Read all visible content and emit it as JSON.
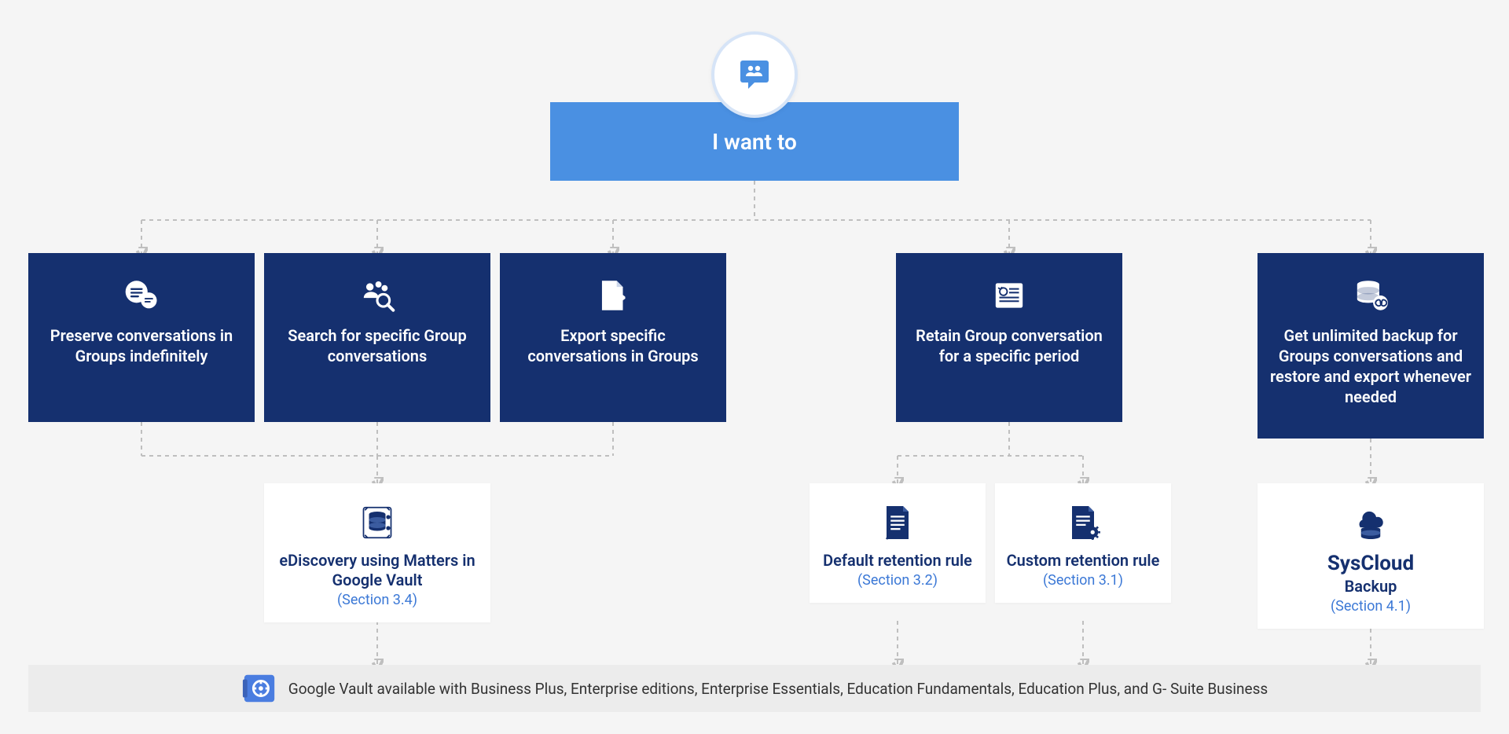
{
  "root": {
    "title": "I want to",
    "icon": "groups-chat-icon"
  },
  "options": [
    {
      "icon": "chat-bubbles-icon",
      "label": "Preserve conversations in Groups indefinitely"
    },
    {
      "icon": "people-search-icon",
      "label": "Search for specific Group conversations"
    },
    {
      "icon": "file-export-icon",
      "label": "Export specific conversations in Groups"
    },
    {
      "icon": "retention-window-icon",
      "label": "Retain Group conversation for a specific period"
    },
    {
      "icon": "database-infinity-icon",
      "label": "Get unlimited backup for Groups conversations and restore and export whenever needed"
    }
  ],
  "results": [
    {
      "icon": "matters-db-icon",
      "title": "eDiscovery using Matters in Google Vault",
      "section_link": "(Section 3.4)"
    },
    {
      "icon": "doc-rule-icon",
      "title": "Default retention rule",
      "section_link": "(Section 3.2)"
    },
    {
      "icon": "doc-rule-gear-icon",
      "title": "Custom retention rule",
      "section_link": "(Section 3.1)"
    },
    {
      "icon": "syscloud-backup-icon",
      "title_bold": "SysCloud",
      "title_sub": "Backup",
      "section_link": "(Section 4.1)"
    }
  ],
  "footer": {
    "icon": "vault-icon",
    "text": "Google Vault available with Business Plus, Enterprise editions, Enterprise Essentials, Education Fundamentals, Education Plus, and G- Suite Business"
  },
  "colors": {
    "root_bg": "#4a90e2",
    "option_bg": "#15306f",
    "result_title": "#15306f",
    "link": "#3b78d6",
    "connector": "#bfbfbf"
  }
}
